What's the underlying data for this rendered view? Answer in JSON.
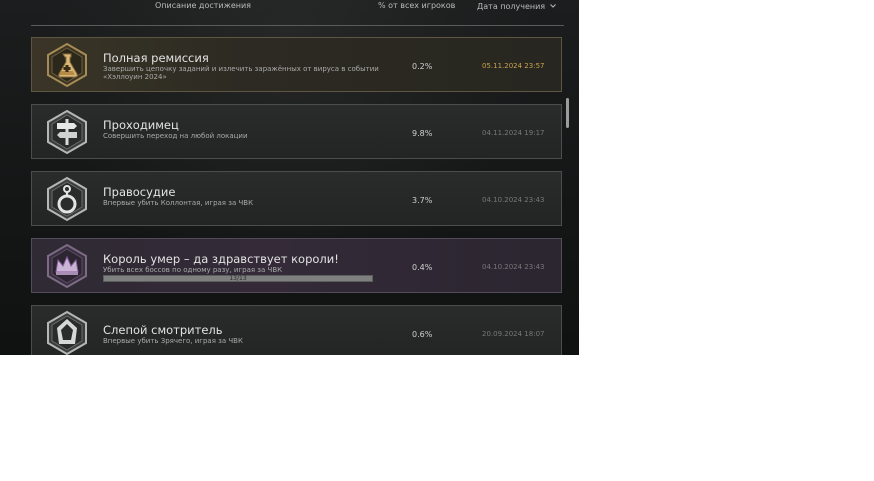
{
  "header": {
    "col_description": "Описание достижения",
    "col_percent": "% от всех игроков",
    "col_date": "Дата получения",
    "sort_icon": "chevron-down-icon"
  },
  "achievements": [
    {
      "title": "Полная ремиссия",
      "description": "Завершить цепочку заданий и излечить заражённых от вируса в событии «Хэллоуин 2024»",
      "percent": "0.2%",
      "date": "05.11.2024 23:57",
      "icon": "flask-icon",
      "style": "gold"
    },
    {
      "title": "Проходимец",
      "description": "Совершить переход на любой локации",
      "percent": "9.8%",
      "date": "04.11.2024 19:17",
      "icon": "signpost-icon",
      "style": "normal"
    },
    {
      "title": "Правосудие",
      "description": "Впервые убить Коллонтая, играя за ЧВК",
      "percent": "3.7%",
      "date": "04.10.2024 23:43",
      "icon": "handcuffs-icon",
      "style": "normal"
    },
    {
      "title": "Король умер – да здравствует короли!",
      "description": "Убить всех боссов по одному разу, играя за ЧВК",
      "percent": "0.4%",
      "date": "04.10.2024 23:43",
      "progress_text": "13/13",
      "progress_fraction": 1.0,
      "icon": "crown-icon",
      "style": "purple"
    },
    {
      "title": "Слепой смотритель",
      "description": "Впервые убить Зрячего, играя за ЧВК",
      "percent": "0.6%",
      "date": "20.09.2024 18:07",
      "icon": "hooded-figure-icon",
      "style": "normal"
    }
  ],
  "colors": {
    "gold_date": "#c9a24f",
    "purple_accent": "#8a5ea0"
  }
}
